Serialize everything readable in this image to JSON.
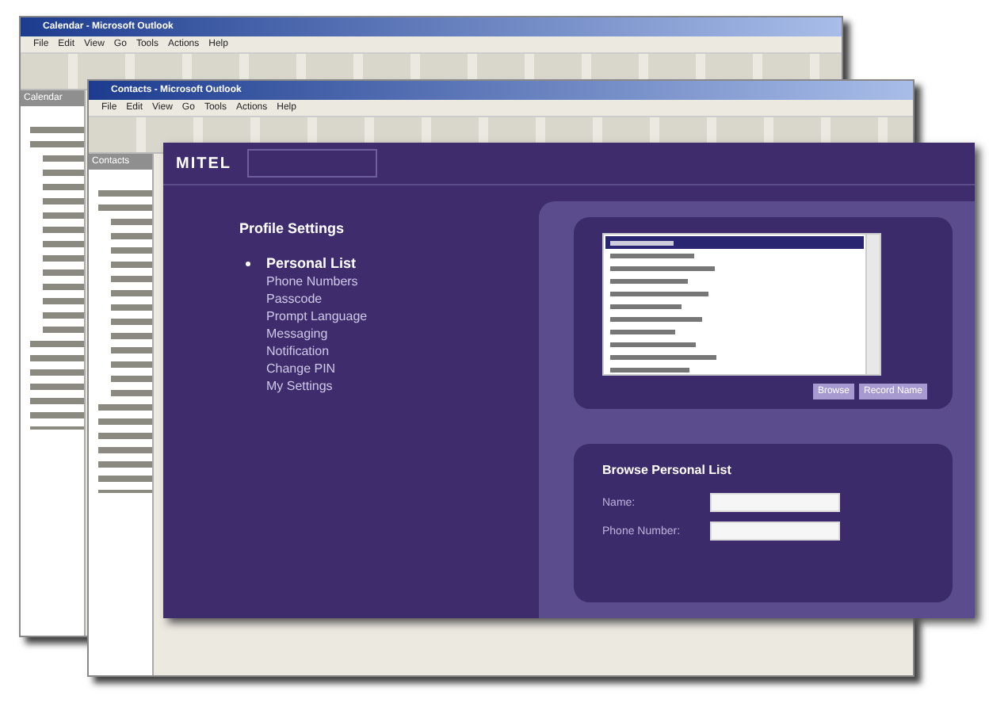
{
  "back_windows": [
    {
      "title": "Calendar - Microsoft Outlook",
      "menu": [
        "File",
        "Edit",
        "View",
        "Go",
        "Tools",
        "Actions",
        "Help"
      ],
      "pane_title": "Calendar"
    },
    {
      "title": "Contacts - Microsoft Outlook",
      "menu": [
        "File",
        "Edit",
        "View",
        "Go",
        "Tools",
        "Actions",
        "Help"
      ],
      "pane_title": "Contacts"
    }
  ],
  "app": {
    "logo": "MITEL",
    "settings_title": "Profile Settings",
    "menu": [
      {
        "label": "Personal List",
        "selected": true
      },
      {
        "label": "Phone Numbers",
        "selected": false
      },
      {
        "label": "Passcode",
        "selected": false
      },
      {
        "label": "Prompt Language",
        "selected": false
      },
      {
        "label": "Messaging",
        "selected": false
      },
      {
        "label": "Notification",
        "selected": false
      },
      {
        "label": "Change PIN",
        "selected": false
      },
      {
        "label": "My Settings",
        "selected": false
      }
    ],
    "list_buttons": [
      "Browse",
      "Record Name"
    ],
    "browse": {
      "title": "Browse Personal List",
      "fields": [
        {
          "label": "Name:"
        },
        {
          "label": "Phone Number:"
        }
      ]
    }
  }
}
